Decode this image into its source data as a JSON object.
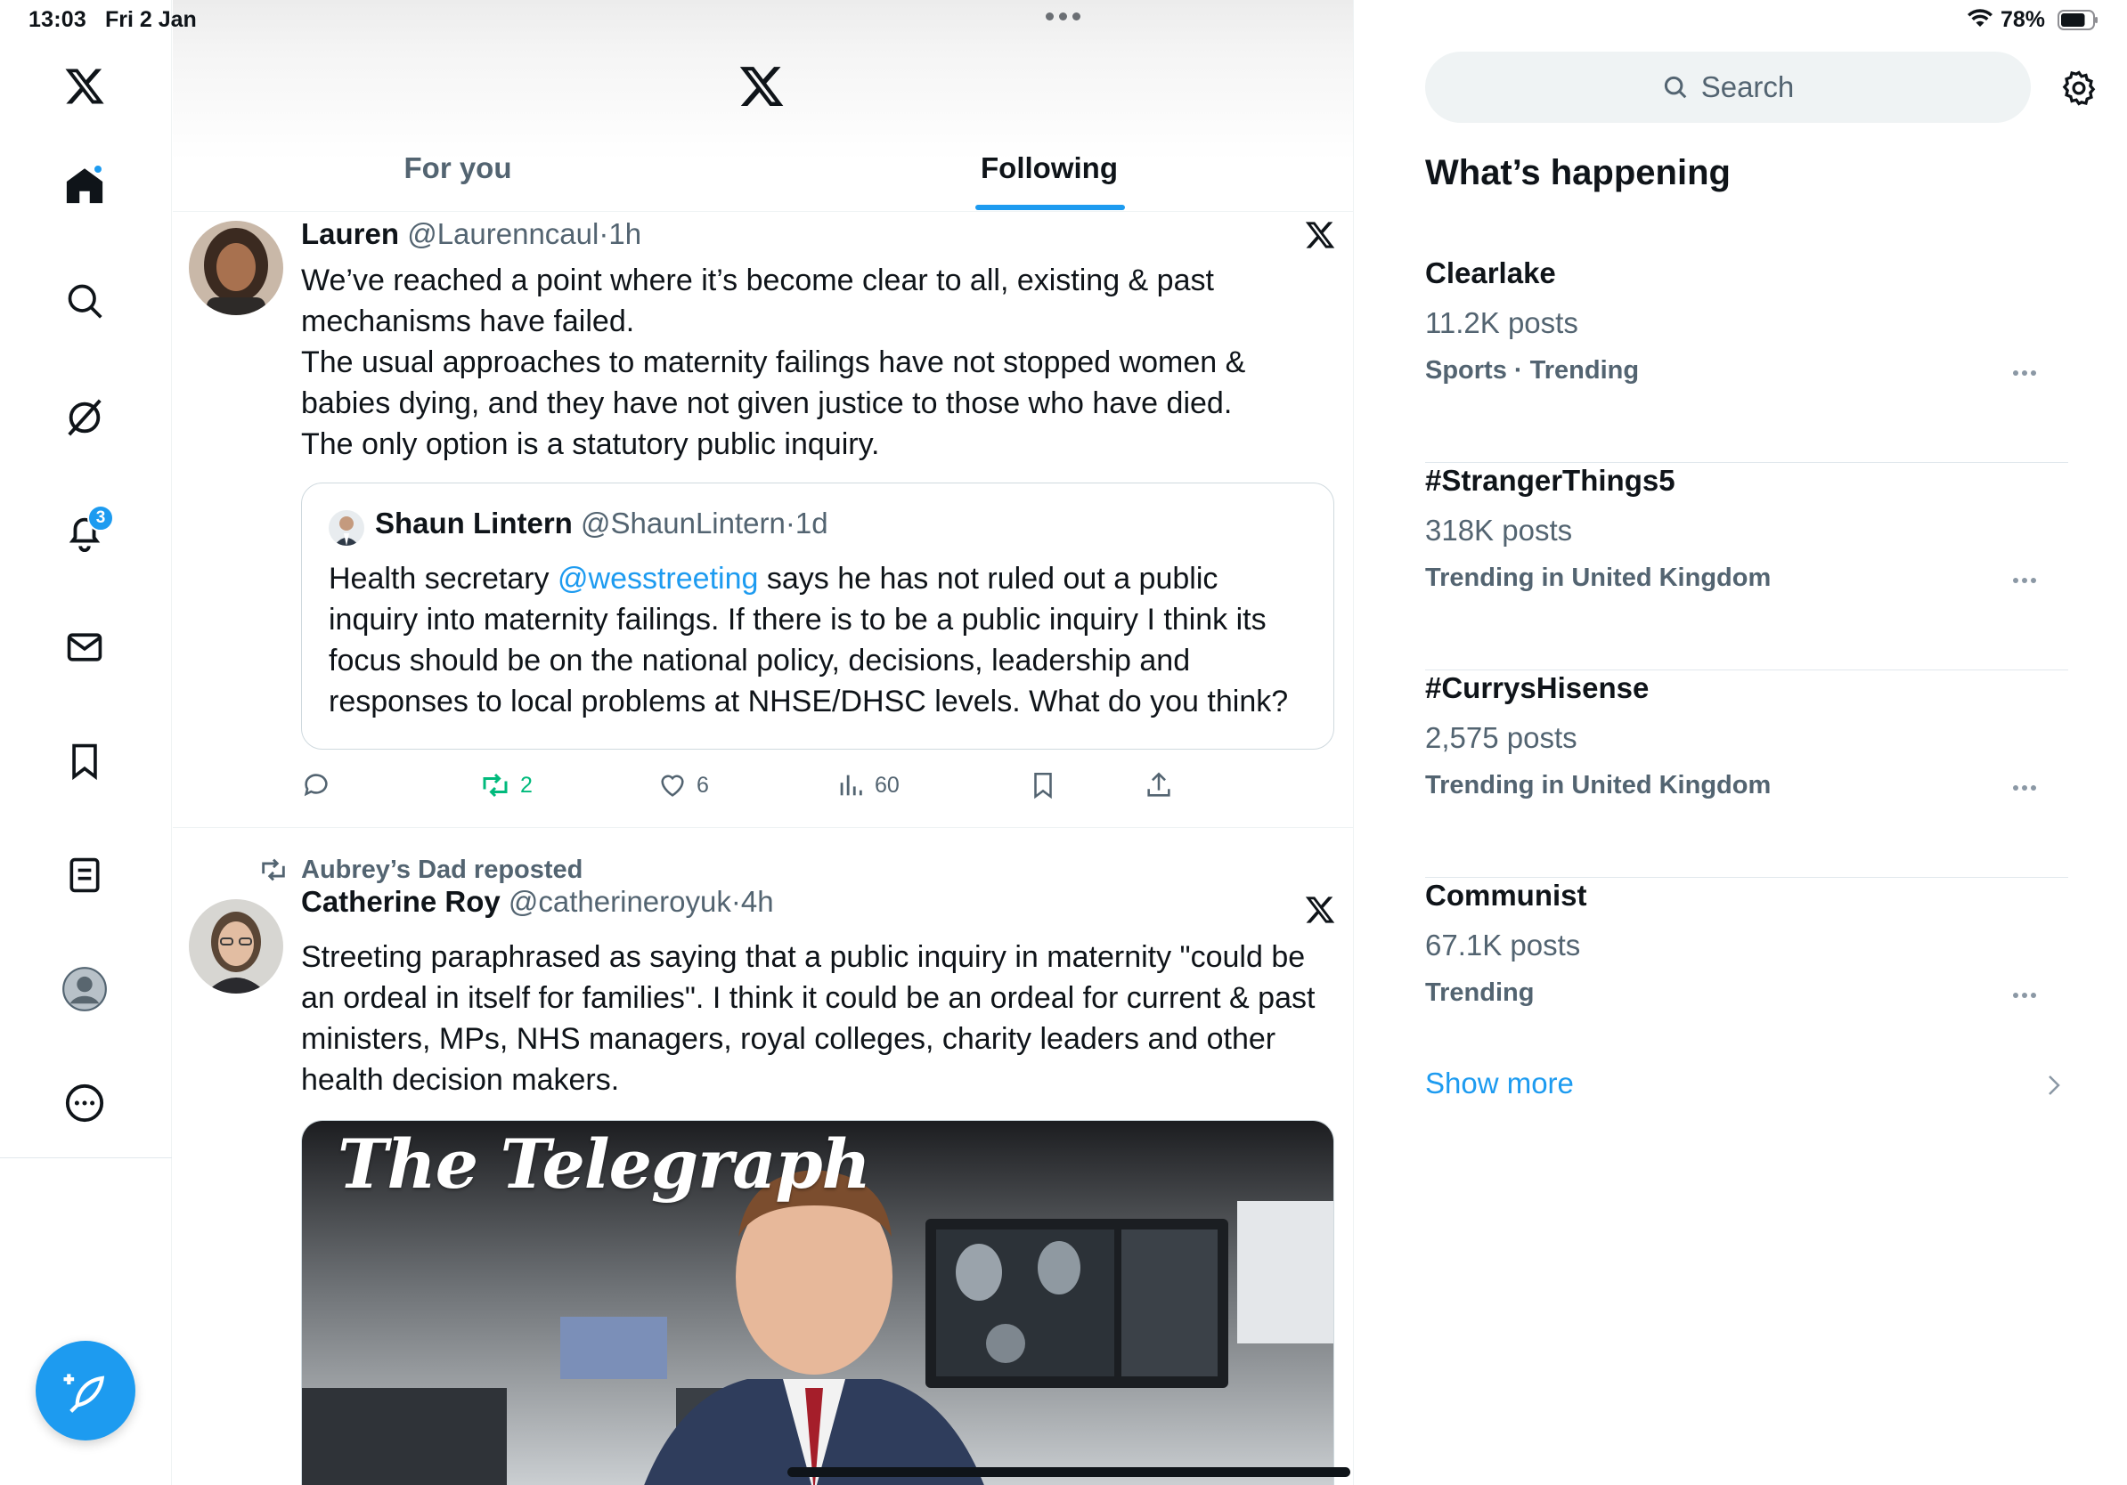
{
  "status_bar": {
    "time": "13:03",
    "date": "Fri 2 Jan",
    "battery_percent": "78%",
    "battery_level": 0.78
  },
  "nav": {
    "items": [
      {
        "name": "x-logo-icon"
      },
      {
        "name": "home-icon",
        "active": true,
        "has_dot": true
      },
      {
        "name": "search-icon"
      },
      {
        "name": "grok-icon"
      },
      {
        "name": "notifications-icon",
        "badge": "3"
      },
      {
        "name": "messages-icon"
      },
      {
        "name": "bookmarks-icon"
      },
      {
        "name": "lists-icon"
      },
      {
        "name": "profile-icon"
      },
      {
        "name": "more-icon"
      }
    ],
    "compose_icon": "compose-feather-icon"
  },
  "header": {
    "tabs": [
      {
        "label": "For you",
        "active": false
      },
      {
        "label": "Following",
        "active": true
      }
    ]
  },
  "tweets": [
    {
      "name": "Lauren",
      "handle": "@Laurenncaul",
      "time": "1h",
      "text_lines": [
        "We’ve reached a point where it’s become clear to all, existing & past",
        "mechanisms have failed.",
        "The usual approaches to maternity failings have not stopped women &",
        "babies dying, and they have not given justice to those who have died.",
        "The only option is a statutory public inquiry."
      ],
      "quote": {
        "name": "Shaun Lintern",
        "handle": "@ShaunLintern",
        "time": "1d",
        "text_before_mention": "Health secretary ",
        "mention": "@wesstreeting",
        "text_after_mention": " says he has not ruled out a public",
        "text_lines": [
          "inquiry into maternity failings. If there is to be a public inquiry I think its",
          "focus should be on the national policy, decisions, leadership and",
          "responses to local problems at NHSE/DHSC levels. What do you think?"
        ]
      },
      "actions": {
        "replies": "",
        "reposts": "2",
        "likes": "6",
        "views": "60"
      }
    },
    {
      "reposted_by": "Aubrey’s Dad reposted",
      "name": "Catherine Roy",
      "handle": "@catherineroyuk",
      "time": "4h",
      "text_lines": [
        "Streeting paraphrased as saying that a public inquiry in maternity \"could be",
        "an ordeal in itself for families\". I think it could be an ordeal for current & past",
        "ministers, MPs, NHS managers, royal colleges, charity leaders and other",
        "health decision makers."
      ],
      "media_title": "The Telegraph"
    }
  ],
  "right": {
    "search_placeholder": "Search",
    "section_title": "What’s happening",
    "trends": [
      {
        "name": "Clearlake",
        "count": "11.2K posts",
        "context": "Sports · Trending"
      },
      {
        "name": "#StrangerThings5",
        "count": "318K posts",
        "context": "Trending in United Kingdom"
      },
      {
        "name": "#CurrysHisense",
        "count": "2,575 posts",
        "context": "Trending in United Kingdom"
      },
      {
        "name": "Communist",
        "count": "67.1K posts",
        "context": "Trending"
      }
    ],
    "show_more": "Show more"
  },
  "colors": {
    "accent": "#1d9bf0",
    "repost_green": "#00ba7c",
    "secondary_text": "#536471",
    "primary_text": "#0f1419"
  }
}
